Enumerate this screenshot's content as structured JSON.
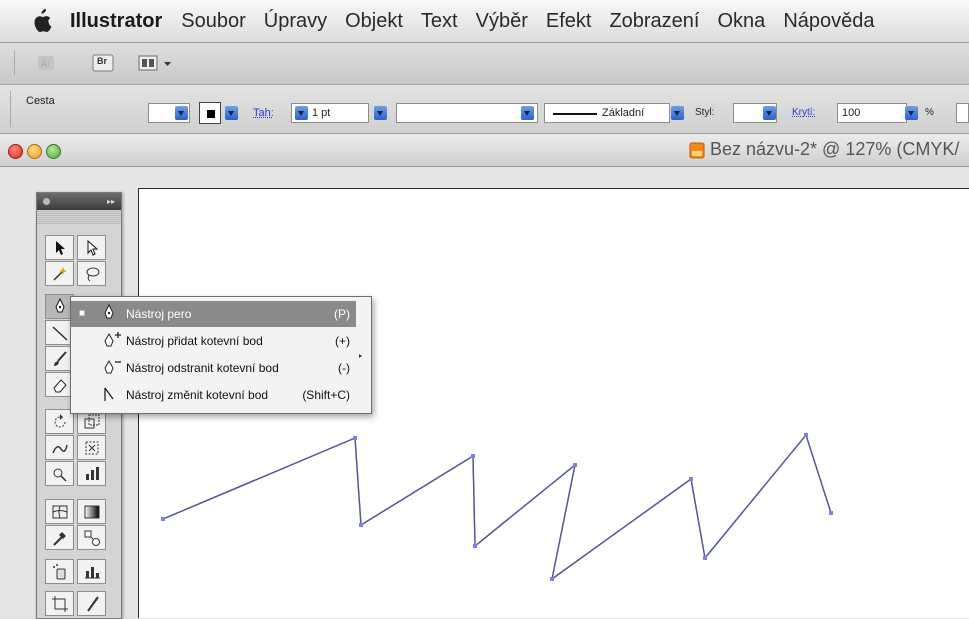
{
  "menubar": {
    "app_name": "Illustrator",
    "items": [
      "Soubor",
      "Úpravy",
      "Objekt",
      "Text",
      "Výběr",
      "Efekt",
      "Zobrazení",
      "Okna",
      "Nápověda"
    ]
  },
  "appbar": {
    "bridge_label": "Br"
  },
  "control_bar": {
    "path_label": "Cesta",
    "stroke_label": "Tah:",
    "stroke_weight": "1 pt",
    "brush_label": "Základní",
    "style_label": "Styl:",
    "opacity_label": "Krytí:",
    "opacity_value": "100",
    "percent": "%"
  },
  "document": {
    "title": "Bez názvu-2* @ 127% (CMYK/"
  },
  "flyout": {
    "items": [
      {
        "bullet": "■",
        "label": "Nástroj pero",
        "shortcut": "(P)"
      },
      {
        "bullet": "",
        "label": "Nástroj přidat kotevní bod",
        "shortcut": "(+)"
      },
      {
        "bullet": "",
        "label": "Nástroj odstranit kotevní bod",
        "shortcut": "(-)"
      },
      {
        "bullet": "",
        "label": "Nástroj změnit kotevní bod",
        "shortcut": "(Shift+C)"
      }
    ]
  },
  "colors": {
    "path_stroke": "#2a2550",
    "anchor": "#7b80e8",
    "menu_highlight": "#8a8a8a",
    "link_blue": "#2a3ec8"
  },
  "icons": [
    "apple-icon",
    "pen-icon",
    "add-anchor-icon",
    "delete-anchor-icon",
    "convert-anchor-icon"
  ]
}
